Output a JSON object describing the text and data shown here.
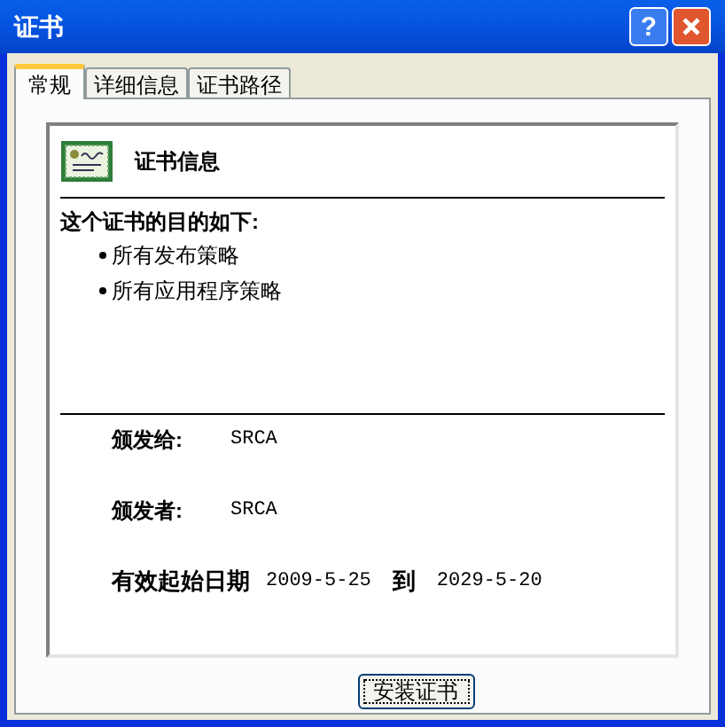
{
  "window": {
    "title": "证书",
    "help_button": "?"
  },
  "tabs": [
    {
      "label": "常规",
      "selected": true
    },
    {
      "label": "详细信息",
      "selected": false
    },
    {
      "label": "证书路径",
      "selected": false
    }
  ],
  "info": {
    "title": "证书信息",
    "purpose_heading": "这个证书的目的如下:",
    "purposes": [
      "所有发布策略",
      "所有应用程序策略"
    ]
  },
  "fields": [
    {
      "label": "颁发给:",
      "value": "SRCA"
    },
    {
      "label": "颁发者:",
      "value": "SRCA"
    }
  ],
  "validity": {
    "label": "有效起始日期",
    "from": "2009-5-25",
    "to_word": "到",
    "to": "2029-5-20"
  },
  "buttons": [
    "安装证书"
  ]
}
